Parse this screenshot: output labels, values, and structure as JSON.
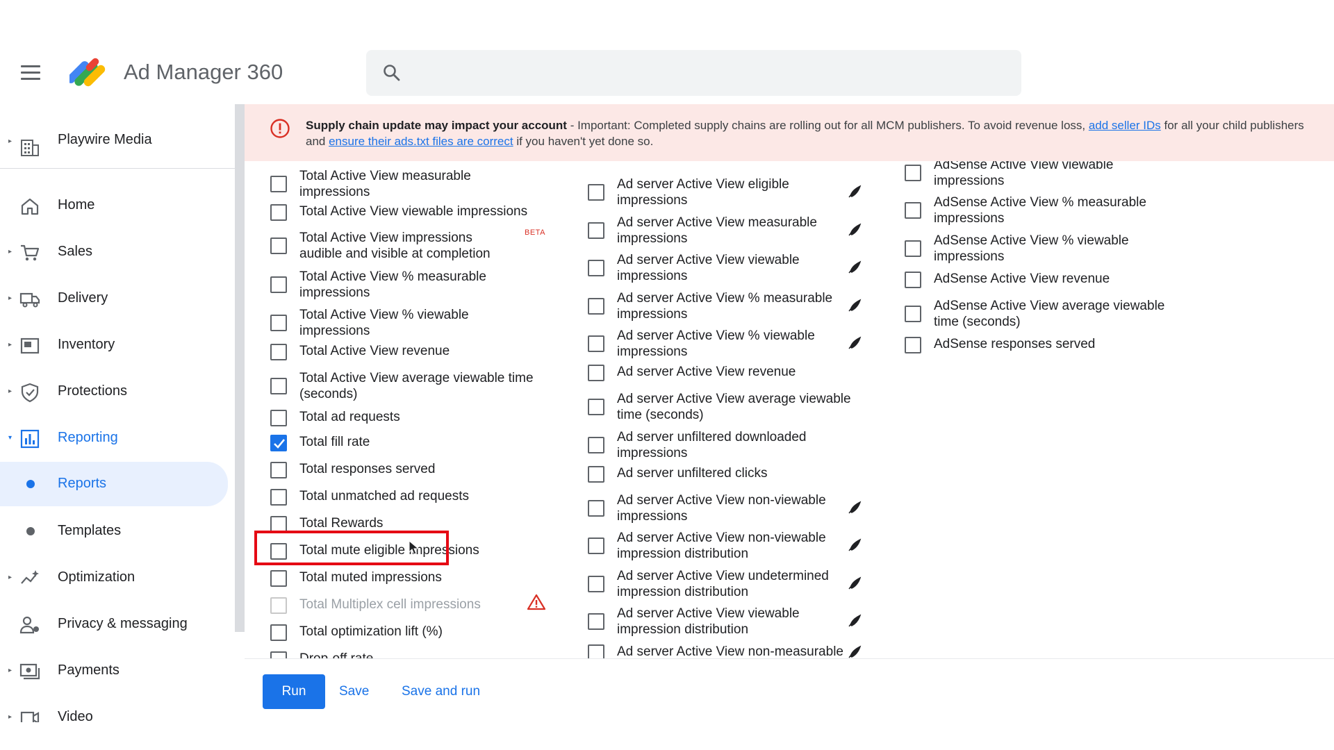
{
  "app": {
    "title": "Ad Manager 360"
  },
  "search": {
    "placeholder": ""
  },
  "sidebar": {
    "account": "Playwire Media",
    "items": [
      {
        "label": "Home",
        "icon": "home-icon"
      },
      {
        "label": "Sales",
        "icon": "cart-icon"
      },
      {
        "label": "Delivery",
        "icon": "truck-icon"
      },
      {
        "label": "Inventory",
        "icon": "inventory-icon"
      },
      {
        "label": "Protections",
        "icon": "shield-icon"
      },
      {
        "label": "Reporting",
        "icon": "bar-chart-icon"
      },
      {
        "label": "Reports",
        "icon": "dot-icon"
      },
      {
        "label": "Templates",
        "icon": "dot-icon"
      },
      {
        "label": "Optimization",
        "icon": "sparkline-icon"
      },
      {
        "label": "Privacy & messaging",
        "icon": "person-icon"
      },
      {
        "label": "Payments",
        "icon": "payments-icon"
      },
      {
        "label": "Video",
        "icon": "video-icon"
      }
    ]
  },
  "banner": {
    "title": "Supply chain update may impact your account",
    "text_1": " - Important: Completed supply chains are rolling out for all MCM publishers. To avoid revenue loss, ",
    "link_1": "add seller IDs",
    "text_2": " for all your child publishers",
    "text_3": "and ",
    "link_2": "ensure their ads.txt files are correct",
    "text_4": " if you haven't yet done so."
  },
  "metrics": {
    "col1": [
      {
        "l1": "Total Active View measurable",
        "l2": "impressions"
      },
      {
        "l1": "Total Active View viewable impressions",
        "l2": ""
      },
      {
        "l1": "Total Active View impressions",
        "l2": "audible and visible at completion",
        "badge": "BETA"
      },
      {
        "l1": "Total Active View % measurable",
        "l2": "impressions"
      },
      {
        "l1": "Total Active View % viewable",
        "l2": "impressions"
      },
      {
        "l1": "Total Active View revenue",
        "l2": ""
      },
      {
        "l1": "Total Active View average viewable time",
        "l2": "(seconds)"
      },
      {
        "l1": "Total ad requests",
        "l2": ""
      },
      {
        "l1": "Total fill rate",
        "l2": "",
        "checked": true
      },
      {
        "l1": "Total responses served",
        "l2": ""
      },
      {
        "l1": "Total unmatched ad requests",
        "l2": ""
      },
      {
        "l1": "Total Rewards",
        "l2": ""
      },
      {
        "l1": "Total mute eligible impressions",
        "l2": ""
      },
      {
        "l1": "Total muted impressions",
        "l2": ""
      },
      {
        "l1": "Total Multiplex cell impressions",
        "l2": "",
        "disabled": true,
        "icon": "warning-triangle-icon"
      },
      {
        "l1": "Total optimization lift (%)",
        "l2": ""
      },
      {
        "l1": "Drop-off rate",
        "l2": ""
      }
    ],
    "col2": [
      {
        "l1": "Ad server Active View eligible",
        "l2": "impressions"
      },
      {
        "l1": "Ad server Active View measurable",
        "l2": "impressions"
      },
      {
        "l1": "Ad server Active View viewable",
        "l2": "impressions"
      },
      {
        "l1": "Ad server Active View % measurable",
        "l2": "impressions"
      },
      {
        "l1": "Ad server Active View % viewable",
        "l2": "impressions"
      },
      {
        "l1": "Ad server Active View revenue",
        "l2": ""
      },
      {
        "l1": "Ad server Active View average viewable",
        "l2": "time (seconds)"
      },
      {
        "l1": "Ad server unfiltered downloaded",
        "l2": "impressions"
      },
      {
        "l1": "Ad server unfiltered clicks",
        "l2": ""
      },
      {
        "l1": "Ad server Active View non-viewable",
        "l2": "impressions"
      },
      {
        "l1": "Ad server Active View non-viewable",
        "l2": "impression distribution"
      },
      {
        "l1": "Ad server Active View undetermined",
        "l2": "impression distribution"
      },
      {
        "l1": "Ad server Active View viewable",
        "l2": "impression distribution"
      },
      {
        "l1": "Ad server Active View non-measurable",
        "l2": ""
      }
    ],
    "col3": [
      {
        "l1": "AdSense Active View viewable",
        "l2": "impressions"
      },
      {
        "l1": "AdSense Active View % measurable",
        "l2": "impressions"
      },
      {
        "l1": "AdSense Active View % viewable",
        "l2": "impressions"
      },
      {
        "l1": "AdSense Active View revenue",
        "l2": ""
      },
      {
        "l1": "AdSense Active View average viewable",
        "l2": "time (seconds)"
      },
      {
        "l1": "AdSense responses served",
        "l2": ""
      }
    ]
  },
  "footer": {
    "run": "Run",
    "save": "Save",
    "save_and_run": "Save and run"
  },
  "colors": {
    "accent": "#1a73e8",
    "banner_bg": "#fce8e6",
    "highlight": "#e50914",
    "selected_nav_bg": "#e8f0fe"
  }
}
